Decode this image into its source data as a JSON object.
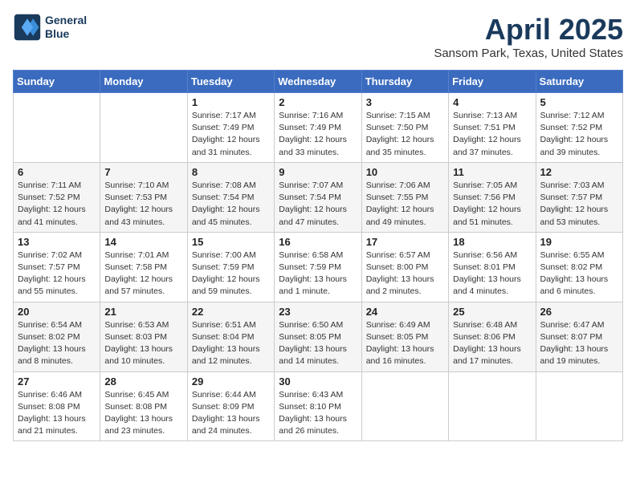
{
  "header": {
    "logo_line1": "General",
    "logo_line2": "Blue",
    "month": "April 2025",
    "location": "Sansom Park, Texas, United States"
  },
  "weekdays": [
    "Sunday",
    "Monday",
    "Tuesday",
    "Wednesday",
    "Thursday",
    "Friday",
    "Saturday"
  ],
  "weeks": [
    [
      {
        "day": "",
        "info": ""
      },
      {
        "day": "",
        "info": ""
      },
      {
        "day": "1",
        "info": "Sunrise: 7:17 AM\nSunset: 7:49 PM\nDaylight: 12 hours\nand 31 minutes."
      },
      {
        "day": "2",
        "info": "Sunrise: 7:16 AM\nSunset: 7:49 PM\nDaylight: 12 hours\nand 33 minutes."
      },
      {
        "day": "3",
        "info": "Sunrise: 7:15 AM\nSunset: 7:50 PM\nDaylight: 12 hours\nand 35 minutes."
      },
      {
        "day": "4",
        "info": "Sunrise: 7:13 AM\nSunset: 7:51 PM\nDaylight: 12 hours\nand 37 minutes."
      },
      {
        "day": "5",
        "info": "Sunrise: 7:12 AM\nSunset: 7:52 PM\nDaylight: 12 hours\nand 39 minutes."
      }
    ],
    [
      {
        "day": "6",
        "info": "Sunrise: 7:11 AM\nSunset: 7:52 PM\nDaylight: 12 hours\nand 41 minutes."
      },
      {
        "day": "7",
        "info": "Sunrise: 7:10 AM\nSunset: 7:53 PM\nDaylight: 12 hours\nand 43 minutes."
      },
      {
        "day": "8",
        "info": "Sunrise: 7:08 AM\nSunset: 7:54 PM\nDaylight: 12 hours\nand 45 minutes."
      },
      {
        "day": "9",
        "info": "Sunrise: 7:07 AM\nSunset: 7:54 PM\nDaylight: 12 hours\nand 47 minutes."
      },
      {
        "day": "10",
        "info": "Sunrise: 7:06 AM\nSunset: 7:55 PM\nDaylight: 12 hours\nand 49 minutes."
      },
      {
        "day": "11",
        "info": "Sunrise: 7:05 AM\nSunset: 7:56 PM\nDaylight: 12 hours\nand 51 minutes."
      },
      {
        "day": "12",
        "info": "Sunrise: 7:03 AM\nSunset: 7:57 PM\nDaylight: 12 hours\nand 53 minutes."
      }
    ],
    [
      {
        "day": "13",
        "info": "Sunrise: 7:02 AM\nSunset: 7:57 PM\nDaylight: 12 hours\nand 55 minutes."
      },
      {
        "day": "14",
        "info": "Sunrise: 7:01 AM\nSunset: 7:58 PM\nDaylight: 12 hours\nand 57 minutes."
      },
      {
        "day": "15",
        "info": "Sunrise: 7:00 AM\nSunset: 7:59 PM\nDaylight: 12 hours\nand 59 minutes."
      },
      {
        "day": "16",
        "info": "Sunrise: 6:58 AM\nSunset: 7:59 PM\nDaylight: 13 hours\nand 1 minute."
      },
      {
        "day": "17",
        "info": "Sunrise: 6:57 AM\nSunset: 8:00 PM\nDaylight: 13 hours\nand 2 minutes."
      },
      {
        "day": "18",
        "info": "Sunrise: 6:56 AM\nSunset: 8:01 PM\nDaylight: 13 hours\nand 4 minutes."
      },
      {
        "day": "19",
        "info": "Sunrise: 6:55 AM\nSunset: 8:02 PM\nDaylight: 13 hours\nand 6 minutes."
      }
    ],
    [
      {
        "day": "20",
        "info": "Sunrise: 6:54 AM\nSunset: 8:02 PM\nDaylight: 13 hours\nand 8 minutes."
      },
      {
        "day": "21",
        "info": "Sunrise: 6:53 AM\nSunset: 8:03 PM\nDaylight: 13 hours\nand 10 minutes."
      },
      {
        "day": "22",
        "info": "Sunrise: 6:51 AM\nSunset: 8:04 PM\nDaylight: 13 hours\nand 12 minutes."
      },
      {
        "day": "23",
        "info": "Sunrise: 6:50 AM\nSunset: 8:05 PM\nDaylight: 13 hours\nand 14 minutes."
      },
      {
        "day": "24",
        "info": "Sunrise: 6:49 AM\nSunset: 8:05 PM\nDaylight: 13 hours\nand 16 minutes."
      },
      {
        "day": "25",
        "info": "Sunrise: 6:48 AM\nSunset: 8:06 PM\nDaylight: 13 hours\nand 17 minutes."
      },
      {
        "day": "26",
        "info": "Sunrise: 6:47 AM\nSunset: 8:07 PM\nDaylight: 13 hours\nand 19 minutes."
      }
    ],
    [
      {
        "day": "27",
        "info": "Sunrise: 6:46 AM\nSunset: 8:08 PM\nDaylight: 13 hours\nand 21 minutes."
      },
      {
        "day": "28",
        "info": "Sunrise: 6:45 AM\nSunset: 8:08 PM\nDaylight: 13 hours\nand 23 minutes."
      },
      {
        "day": "29",
        "info": "Sunrise: 6:44 AM\nSunset: 8:09 PM\nDaylight: 13 hours\nand 24 minutes."
      },
      {
        "day": "30",
        "info": "Sunrise: 6:43 AM\nSunset: 8:10 PM\nDaylight: 13 hours\nand 26 minutes."
      },
      {
        "day": "",
        "info": ""
      },
      {
        "day": "",
        "info": ""
      },
      {
        "day": "",
        "info": ""
      }
    ]
  ]
}
